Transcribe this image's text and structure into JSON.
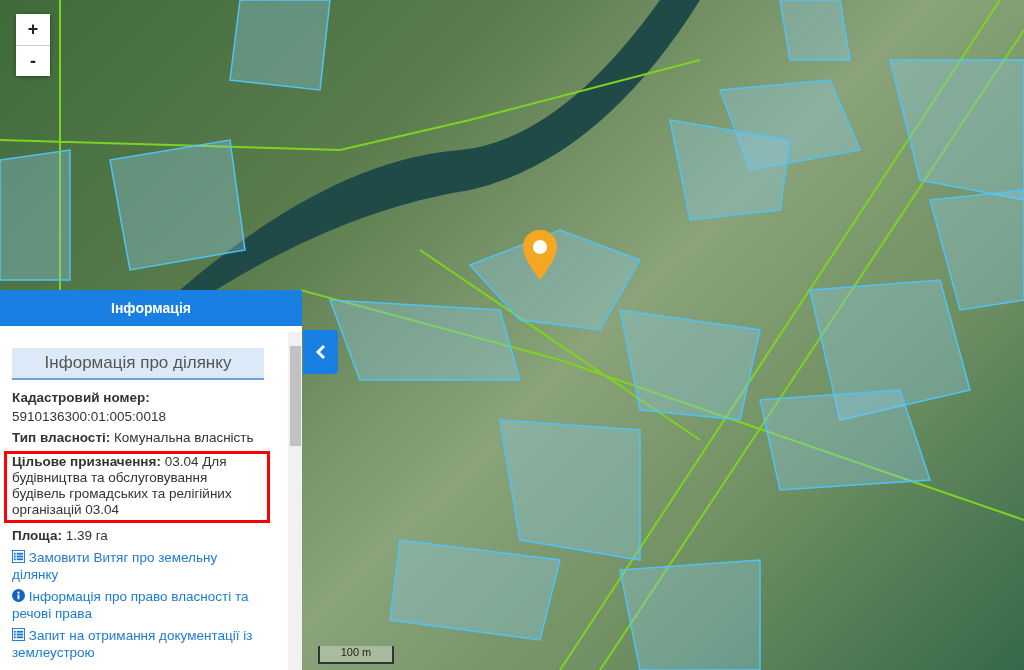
{
  "map": {
    "zoom_buttons": [
      {
        "label": "+"
      },
      {
        "label": "-"
      }
    ],
    "scale_label": "100 m"
  },
  "panel": {
    "title": "Інформація",
    "section_title": "Інформація про ділянку",
    "fields": [
      {
        "kind": "block",
        "label": "Кадастровий номер:",
        "value": "5910136300:01:005:0018",
        "highlighted": false
      },
      {
        "kind": "inline",
        "text": "**Тип власності:** Комунальна власність",
        "highlighted": false
      },
      {
        "kind": "inline",
        "text": "**Цільове призначення:** 03.04 Для будівництва та обслуговування будівель громадських та релігійних організацій 03.04",
        "highlighted": true
      },
      {
        "kind": "inline",
        "text": "**Площа:** 1.39 га",
        "highlighted": false
      }
    ],
    "links": [
      {
        "kind": "document",
        "text": "Замовити Витяг про земельну ділянку"
      },
      {
        "kind": "info",
        "text": "Інформація про право власності та речові права"
      },
      {
        "kind": "document",
        "text": "Запит на отримання документації із землеустрою"
      }
    ]
  }
}
